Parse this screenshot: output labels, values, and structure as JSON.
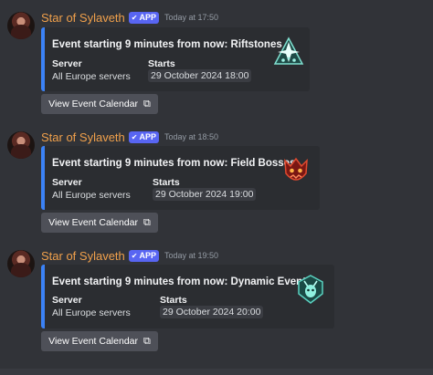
{
  "messages": [
    {
      "author": "Star of Sylaveth",
      "badge": "APP",
      "timestamp": "Today at 17:50",
      "embed_title": "Event starting 9 minutes from now: Riftstones",
      "server_label": "Server",
      "server_value": "All Europe servers",
      "starts_label": "Starts",
      "starts_value": "29 October 2024 18:00",
      "thumbnail_icon": "riftstone-icon",
      "button_label": "View Event Calendar"
    },
    {
      "author": "Star of Sylaveth",
      "badge": "APP",
      "timestamp": "Today at 18:50",
      "embed_title": "Event starting 9 minutes from now: Field Bosses",
      "server_label": "Server",
      "server_value": "All Europe servers",
      "starts_label": "Starts",
      "starts_value": "29 October 2024 19:00",
      "thumbnail_icon": "field-boss-icon",
      "button_label": "View Event Calendar"
    },
    {
      "author": "Star of Sylaveth",
      "badge": "APP",
      "timestamp": "Today at 19:50",
      "embed_title": "Event starting 9 minutes from now: Dynamic Events",
      "server_label": "Server",
      "server_value": "All Europe servers",
      "starts_label": "Starts",
      "starts_value": "29 October 2024 20:00",
      "thumbnail_icon": "dynamic-event-icon",
      "button_label": "View Event Calendar"
    }
  ],
  "colors": {
    "background": "#313338",
    "embed_background": "#2b2d31",
    "embed_accent": "#3b82f6",
    "author": "#f0a04b",
    "app_badge": "#5865f2",
    "button": "#4e5058"
  }
}
